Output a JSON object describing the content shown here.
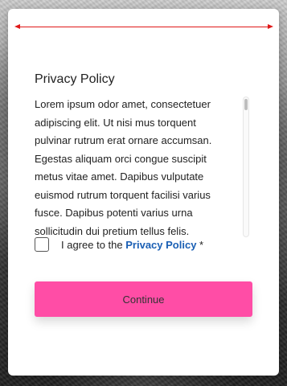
{
  "modal": {
    "title": "Privacy Policy",
    "policy_text": "Lorem ipsum odor amet, consectetuer adipiscing elit. Ut nisi mus torquent pulvinar rutrum erat ornare accumsan. Egestas aliquam orci congue suscipit metus vitae amet. Dapibus vulputate euismod rutrum torquent facilisi varius fusce. Dapibus potenti varius urna sollicitudin dui pretium tellus felis.",
    "agree": {
      "prefix": "I agree to the",
      "link": "Privacy Policy",
      "required_marker": "*",
      "checked": false
    },
    "continue_label": "Continue"
  },
  "colors": {
    "accent": "#ff4da6",
    "link": "#1a5fb4",
    "annotation_arrow": "#e01818"
  },
  "icons": {
    "annotation": "double-headed-arrow-icon",
    "checkbox": "checkbox-icon"
  }
}
